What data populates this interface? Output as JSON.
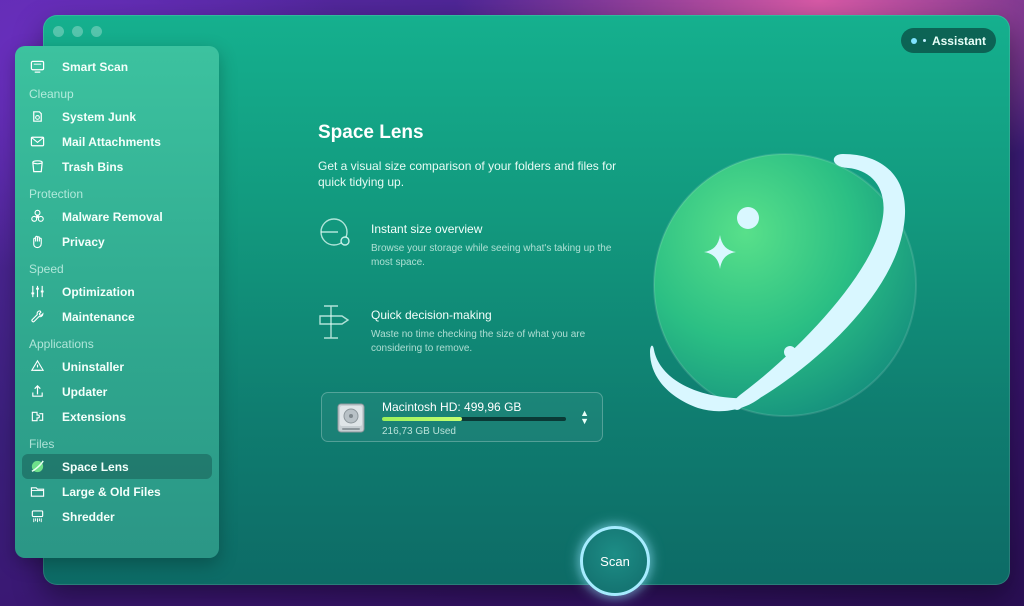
{
  "window": {
    "assistant_label": "Assistant"
  },
  "sidebar": {
    "top_item": {
      "label": "Smart Scan",
      "icon": "monitor-icon"
    },
    "sections": [
      {
        "header": "Cleanup",
        "items": [
          {
            "label": "System Junk",
            "icon": "system-junk-icon"
          },
          {
            "label": "Mail Attachments",
            "icon": "mail-icon"
          },
          {
            "label": "Trash Bins",
            "icon": "trash-icon"
          }
        ]
      },
      {
        "header": "Protection",
        "items": [
          {
            "label": "Malware Removal",
            "icon": "biohazard-icon"
          },
          {
            "label": "Privacy",
            "icon": "hand-icon"
          }
        ]
      },
      {
        "header": "Speed",
        "items": [
          {
            "label": "Optimization",
            "icon": "sliders-icon"
          },
          {
            "label": "Maintenance",
            "icon": "wrench-icon"
          }
        ]
      },
      {
        "header": "Applications",
        "items": [
          {
            "label": "Uninstaller",
            "icon": "uninstaller-icon"
          },
          {
            "label": "Updater",
            "icon": "updater-icon"
          },
          {
            "label": "Extensions",
            "icon": "extensions-icon"
          }
        ]
      },
      {
        "header": "Files",
        "items": [
          {
            "label": "Space Lens",
            "icon": "space-lens-icon",
            "active": true
          },
          {
            "label": "Large & Old Files",
            "icon": "folder-icon"
          },
          {
            "label": "Shredder",
            "icon": "shredder-icon"
          }
        ]
      }
    ]
  },
  "main": {
    "title": "Space Lens",
    "description": "Get a visual size comparison of your folders and files for quick tidying up.",
    "features": [
      {
        "title": "Instant size overview",
        "description": "Browse your storage while seeing what's taking up the most space.",
        "icon": "size-overview-icon"
      },
      {
        "title": "Quick decision-making",
        "description": "Waste no time checking the size of what you are considering to remove.",
        "icon": "decision-icon"
      }
    ],
    "disk": {
      "name": "Macintosh HD: 499,96 GB",
      "used": "216,73 GB Used",
      "used_fraction": 0.4335,
      "icon": "hard-drive-icon"
    },
    "scan_label": "Scan"
  },
  "colors": {
    "accent": "#15b08e",
    "progress": "#b6f96a",
    "scan_ring": "#a6ecff"
  }
}
